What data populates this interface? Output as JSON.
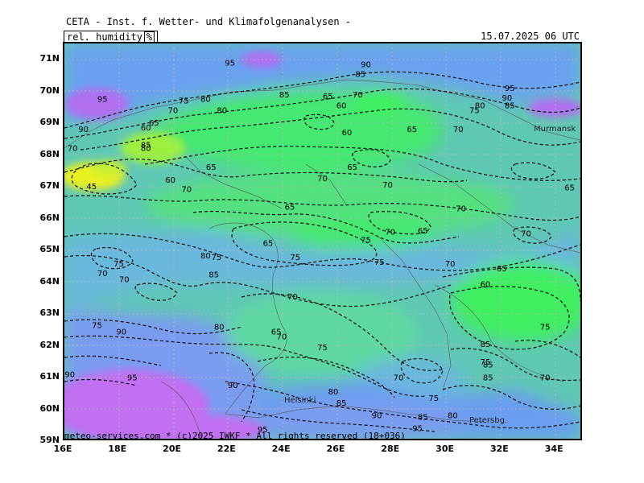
{
  "header": {
    "title": "CETA - Inst. f. Wetter- und Klimafolgenanalysen -",
    "parameter": "rel. humidity",
    "unit": "%",
    "datetime": "15.07.2025 06 UTC"
  },
  "axes": {
    "latitudes": [
      "71N",
      "70N",
      "69N",
      "68N",
      "67N",
      "66N",
      "65N",
      "64N",
      "63N",
      "62N",
      "61N",
      "60N",
      "59N"
    ],
    "longitudes": [
      "16E",
      "18E",
      "20E",
      "22E",
      "24E",
      "26E",
      "28E",
      "30E",
      "32E",
      "34E"
    ]
  },
  "cities": [
    "Murmansk",
    "Helsinki",
    "Petersbg."
  ],
  "credit": "meteo-services.com * (c)2025 IWKF * All rights reserved (18+036)",
  "contour_labels": [
    {
      "text": "95",
      "lon": 22.1,
      "lat": 70.9
    },
    {
      "text": "90",
      "lon": 27.1,
      "lat": 70.85
    },
    {
      "text": "85",
      "lon": 26.9,
      "lat": 70.55
    },
    {
      "text": "95",
      "lon": 17.4,
      "lat": 69.75
    },
    {
      "text": "75",
      "lon": 20.4,
      "lat": 69.7
    },
    {
      "text": "80",
      "lon": 21.2,
      "lat": 69.75
    },
    {
      "text": "85",
      "lon": 24.1,
      "lat": 69.9
    },
    {
      "text": "65",
      "lon": 25.7,
      "lat": 69.85
    },
    {
      "text": "70",
      "lon": 26.8,
      "lat": 69.9
    },
    {
      "text": "60",
      "lon": 26.2,
      "lat": 69.55
    },
    {
      "text": "80",
      "lon": 21.8,
      "lat": 69.4
    },
    {
      "text": "70",
      "lon": 20.0,
      "lat": 69.4
    },
    {
      "text": "95",
      "lon": 32.4,
      "lat": 70.1
    },
    {
      "text": "90",
      "lon": 32.3,
      "lat": 69.8
    },
    {
      "text": "85",
      "lon": 32.4,
      "lat": 69.55
    },
    {
      "text": "80",
      "lon": 31.3,
      "lat": 69.55
    },
    {
      "text": "75",
      "lon": 31.1,
      "lat": 69.4
    },
    {
      "text": "65",
      "lon": 19.3,
      "lat": 69.0
    },
    {
      "text": "60",
      "lon": 19.0,
      "lat": 68.85
    },
    {
      "text": "90",
      "lon": 16.7,
      "lat": 68.8
    },
    {
      "text": "60",
      "lon": 26.4,
      "lat": 68.7
    },
    {
      "text": "65",
      "lon": 28.8,
      "lat": 68.8
    },
    {
      "text": "70",
      "lon": 30.5,
      "lat": 68.8
    },
    {
      "text": "70",
      "lon": 16.3,
      "lat": 68.2
    },
    {
      "text": "85",
      "lon": 19.0,
      "lat": 68.3
    },
    {
      "text": "80",
      "lon": 19.0,
      "lat": 68.2
    },
    {
      "text": "65",
      "lon": 21.4,
      "lat": 67.6
    },
    {
      "text": "65",
      "lon": 26.6,
      "lat": 67.6
    },
    {
      "text": "70",
      "lon": 25.5,
      "lat": 67.25
    },
    {
      "text": "60",
      "lon": 19.9,
      "lat": 67.2
    },
    {
      "text": "45",
      "lon": 17.0,
      "lat": 67.0
    },
    {
      "text": "70",
      "lon": 20.5,
      "lat": 66.9
    },
    {
      "text": "70",
      "lon": 27.9,
      "lat": 67.05
    },
    {
      "text": "65",
      "lon": 34.6,
      "lat": 66.95
    },
    {
      "text": "65",
      "lon": 24.3,
      "lat": 66.35
    },
    {
      "text": "70",
      "lon": 30.6,
      "lat": 66.3
    },
    {
      "text": "70",
      "lon": 28.0,
      "lat": 65.55
    },
    {
      "text": "65",
      "lon": 29.2,
      "lat": 65.6
    },
    {
      "text": "70",
      "lon": 33.0,
      "lat": 65.5
    },
    {
      "text": "75",
      "lon": 27.1,
      "lat": 65.3
    },
    {
      "text": "65",
      "lon": 23.5,
      "lat": 65.2
    },
    {
      "text": "75",
      "lon": 24.5,
      "lat": 64.75
    },
    {
      "text": "75",
      "lon": 27.6,
      "lat": 64.6
    },
    {
      "text": "70",
      "lon": 30.2,
      "lat": 64.55
    },
    {
      "text": "65",
      "lon": 32.1,
      "lat": 64.4
    },
    {
      "text": "80",
      "lon": 21.2,
      "lat": 64.8
    },
    {
      "text": "75",
      "lon": 21.6,
      "lat": 64.75
    },
    {
      "text": "75",
      "lon": 18.0,
      "lat": 64.55
    },
    {
      "text": "85",
      "lon": 21.5,
      "lat": 64.2
    },
    {
      "text": "70",
      "lon": 17.4,
      "lat": 64.25
    },
    {
      "text": "70",
      "lon": 18.2,
      "lat": 64.05
    },
    {
      "text": "60",
      "lon": 31.5,
      "lat": 63.9
    },
    {
      "text": "70",
      "lon": 24.4,
      "lat": 63.5
    },
    {
      "text": "75",
      "lon": 17.2,
      "lat": 62.6
    },
    {
      "text": "90",
      "lon": 18.1,
      "lat": 62.4
    },
    {
      "text": "80",
      "lon": 21.7,
      "lat": 62.55
    },
    {
      "text": "65",
      "lon": 23.8,
      "lat": 62.4
    },
    {
      "text": "70",
      "lon": 24.0,
      "lat": 62.25
    },
    {
      "text": "75",
      "lon": 25.5,
      "lat": 61.9
    },
    {
      "text": "85",
      "lon": 31.5,
      "lat": 62.0
    },
    {
      "text": "75",
      "lon": 33.7,
      "lat": 62.55
    },
    {
      "text": "75",
      "lon": 31.5,
      "lat": 61.45
    },
    {
      "text": "85",
      "lon": 31.6,
      "lat": 61.35
    },
    {
      "text": "85",
      "lon": 31.6,
      "lat": 60.95
    },
    {
      "text": "70",
      "lon": 33.7,
      "lat": 60.95
    },
    {
      "text": "70",
      "lon": 28.3,
      "lat": 60.95
    },
    {
      "text": "90",
      "lon": 16.2,
      "lat": 61.05
    },
    {
      "text": "95",
      "lon": 18.5,
      "lat": 60.95
    },
    {
      "text": "90",
      "lon": 22.2,
      "lat": 60.7
    },
    {
      "text": "80",
      "lon": 25.9,
      "lat": 60.5
    },
    {
      "text": "75",
      "lon": 29.6,
      "lat": 60.3
    },
    {
      "text": "85",
      "lon": 26.2,
      "lat": 60.15
    },
    {
      "text": "90",
      "lon": 27.5,
      "lat": 59.75
    },
    {
      "text": "85",
      "lon": 29.2,
      "lat": 59.7
    },
    {
      "text": "80",
      "lon": 30.3,
      "lat": 59.75
    },
    {
      "text": "95",
      "lon": 29.0,
      "lat": 59.35
    },
    {
      "text": "95",
      "lon": 23.3,
      "lat": 59.3
    }
  ]
}
